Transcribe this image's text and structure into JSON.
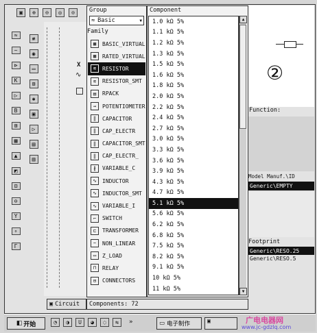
{
  "toolbar": {
    "icons": [
      "component-icon",
      "zoom-in-icon",
      "zoom-out-icon",
      "zoom-area-icon",
      "zoom-fit-icon"
    ]
  },
  "group": {
    "label": "Group",
    "value": "Basic"
  },
  "family": {
    "label": "Family",
    "items": [
      "BASIC_VIRTUAL",
      "RATED_VIRTUAL",
      "RESISTOR",
      "RESISTOR_SMT",
      "RPACK",
      "POTENTIOMETER",
      "CAPACITOR",
      "CAP_ELECTR",
      "CAPACITOR_SMT",
      "CAP_ELECTR_",
      "VARIABLE_C",
      "INDUCTOR",
      "INDUCTOR_SMT",
      "VARIABLE_I",
      "SWITCH",
      "TRANSFORMER",
      "NON_LINEAR",
      "Z_LOAD",
      "RELAY",
      "CONNECTORS"
    ],
    "selected_index": 2
  },
  "component": {
    "label": "Component",
    "items": [
      "1.0 kΩ 5%",
      "1.1 kΩ 5%",
      "1.2 kΩ 5%",
      "1.3 kΩ 5%",
      "1.5 kΩ 5%",
      "1.6 kΩ 5%",
      "1.8 kΩ 5%",
      "2.0 kΩ 5%",
      "2.2 kΩ 5%",
      "2.4 kΩ 5%",
      "2.7 kΩ 5%",
      "3.0 kΩ 5%",
      "3.3 kΩ 5%",
      "3.6 kΩ 5%",
      "3.9 kΩ 5%",
      "4.3 kΩ 5%",
      "4.7 kΩ 5%",
      "5.1 kΩ 5%",
      "5.6 kΩ 5%",
      "6.2 kΩ 5%",
      "6.8 kΩ 5%",
      "7.5 kΩ 5%",
      "8.2 kΩ 5%",
      "9.1 kΩ 5%",
      "10 kΩ 5%",
      "11 kΩ 5%"
    ],
    "selected_index": 17,
    "count_text": "Components: 72"
  },
  "info": {
    "badge": "②",
    "function_label": "Function:",
    "model_label": "Model Manuf.\\ID",
    "model_value": "Generic\\EMPTY",
    "footprint_label": "Footprint",
    "footprint_items": [
      "Generic\\RESO.25",
      "Generic\\RESO.5"
    ]
  },
  "circuit_tab": "Circuit",
  "taskbar": {
    "start": "开始",
    "task1": "电子制作",
    "watermark_1": "广电电器网",
    "watermark_2": "www.jc-gdzlq.com"
  }
}
